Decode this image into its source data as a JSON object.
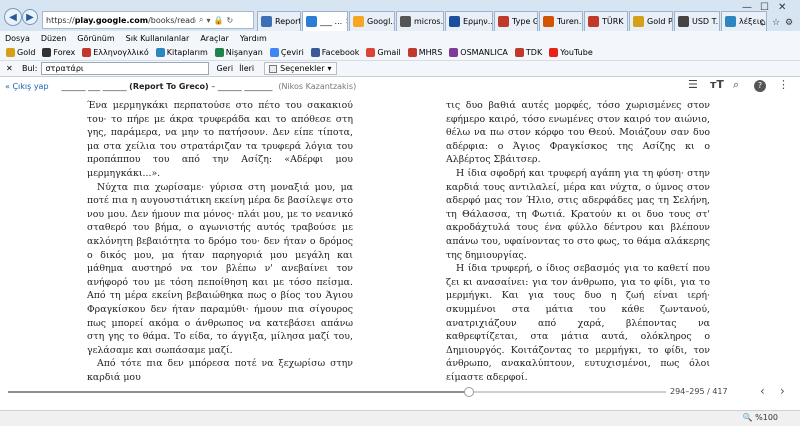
{
  "browser": {
    "address_prefix": "https://",
    "address_domain": "play.google.com",
    "address_suffix": "/books/reader?printsec=fr",
    "tabs": [
      {
        "label": "Report ...",
        "color": "#3c6fb4"
      },
      {
        "label": "___ ...",
        "color": "#2a7fd4",
        "active": true
      },
      {
        "label": "Googl...",
        "color": "#f5a623"
      },
      {
        "label": "micros...",
        "color": "#555555"
      },
      {
        "label": "Ερμην...",
        "color": "#1b4f9c"
      },
      {
        "label": "Type G...",
        "color": "#c0392b"
      },
      {
        "label": "Turen...",
        "color": "#d35400"
      },
      {
        "label": "TÜRK ...",
        "color": "#c0392b"
      },
      {
        "label": "Gold P...",
        "color": "#d4a017"
      },
      {
        "label": "USD T...",
        "color": "#444444"
      },
      {
        "label": "λέξεις ...",
        "color": "#2e86c1"
      }
    ]
  },
  "menu": [
    "Dosya",
    "Düzen",
    "Görünüm",
    "Sık Kullanılanlar",
    "Araçlar",
    "Yardım"
  ],
  "favorites": [
    {
      "label": "Gold",
      "color": "#d4a017"
    },
    {
      "label": "Forex",
      "color": "#333333"
    },
    {
      "label": "Ελληνογλλικό",
      "color": "#c0392b"
    },
    {
      "label": "Kitaplarım",
      "color": "#2e86c1"
    },
    {
      "label": "Nişanyan",
      "color": "#1e8449"
    },
    {
      "label": "Çeviri",
      "color": "#4285f4"
    },
    {
      "label": "Facebook",
      "color": "#3b5998"
    },
    {
      "label": "Gmail",
      "color": "#db4437"
    },
    {
      "label": "MHRS",
      "color": "#c0392b"
    },
    {
      "label": "OSMANLICA",
      "color": "#7d3c98"
    },
    {
      "label": "TDK",
      "color": "#c0392b"
    },
    {
      "label": "YouTube",
      "color": "#e62117"
    }
  ],
  "findbar": {
    "label": "Bul:",
    "value": "στρατάρι",
    "prev": "Geri",
    "next": "İleri",
    "options": "Seçenekler"
  },
  "reader": {
    "back": "« Çıkış yap",
    "title_pre": "______ ___ ______",
    "title_main": "(Report To Greco)",
    "title_dash": "– ______ _______",
    "author": "(Nikos Kazantzakis)",
    "page_indicator": "294–295 / 417",
    "progress": 0.7
  },
  "left_page": [
    {
      "indent": false,
      "text": "Ένα μερμηγκάκι περπατούσε στο πέτο του σακακιού του· το πήρε με άκρα τρυφεράδα και το απόθεσε στη γης, παράμερα, να μην το πατήσουν. Δεν είπε τίποτα, μα στα χείλια του στρατάριζαν τα τρυφερά λόγια του προπάππου του από την Ασίζη: «Αδέρφι μου μερμηγκάκι...»."
    },
    {
      "indent": true,
      "text": "Νύχτα πια χωρίσαμε· γύρισα στη μοναξιά μου, μα ποτέ πια η αυγουστιάτικη εκείνη μέρα δε βασίλεψε στο νου μου. Δεν ήμουν πια μόνος· πλάι μου, με το νεανικό σταθερό του βήμα, ο αγωνιστής αυτός τραβούσε με ακλόνητη βεβαιότητα το δρόμο του· δεν ήταν ο δρόμος ο δικός μου, μα ήταν παρηγοριά μου μεγάλη και μάθημα αυστηρό να τον βλέπω ν' ανεβαίνει τον ανήφορό του με τόση πεποίθηση και με τόσο πείσμα. Από τη μέρα εκείνη βεβαιώθηκα πως ο βίος του Άγιου Φραγκίσκου δεν ήταν παραμύθι· ήμουν πια σίγουρος πως μπορεί ακόμα ο άνθρωπος να κατεβάσει απάνω στη γης το θάμα. Το είδα, το άγγιξα, μίλησα μαζί του, γελάσαμε και σωπάσαμε μαζί."
    },
    {
      "indent": true,
      "text": "Από τότε πια δεν μπόρεσα ποτέ να ξεχωρίσω στην καρδιά μου"
    }
  ],
  "right_page": [
    {
      "indent": false,
      "text": "τις δυο βαθιά αυτές μορφές, τόσο χωρισμένες στον εφήμερο καιρό, τόσο ενωμένες στον καιρό τον αιώνιο, θέλω να πω στον κόρφο του Θεού. Μοιάζουν σαν δυο αδέρφια: ο Άγιος Φραγκίσκος της Ασίζης κι ο Αλβέρτος Σβάιτσερ."
    },
    {
      "indent": true,
      "text": "Η ίδια σφοδρή και τρυφερή αγάπη για τη φύση· στην καρδιά τους αντιλαλεί, μέρα και νύχτα, ο ύμνος στον αδερφό μας τον Ήλιο, στις αδερφάδες μας τη Σελήνη, τη Θάλασσα, τη Φωτιά. Κρατούν κι οι δυο τους στ' ακροδάχτυλά τους ένα φύλλο δέντρου και βλέπουν απάνω του, υφαίνοντας το στο φως, το θάμα αλάκερης της δημιουργίας."
    },
    {
      "indent": true,
      "text": "Η ίδια τρυφερή, ο ίδιος σεβασμός για το καθετί που ζει κι ανασαίνει: για τον άνθρωπο, για το φίδι, για το μερμήγκι. Και για τους δυο η ζωή είναι ιερή· σκυμμένοι στα μάτια του κάθε ζωντανού, ανατριχιάζουν από χαρά, βλέποντας να καθρεφτίζεται, στα μάτια αυτά, ολόκληρος ο Δημιουργός. Κοιτάζοντας το μερμήγκι, το φίδι, τον άνθρωπο, ανακαλύπτουν, ευτυχισμένοι, πως όλοι είμαστε αδερφοί."
    }
  ],
  "status": {
    "zoom": "%100"
  }
}
